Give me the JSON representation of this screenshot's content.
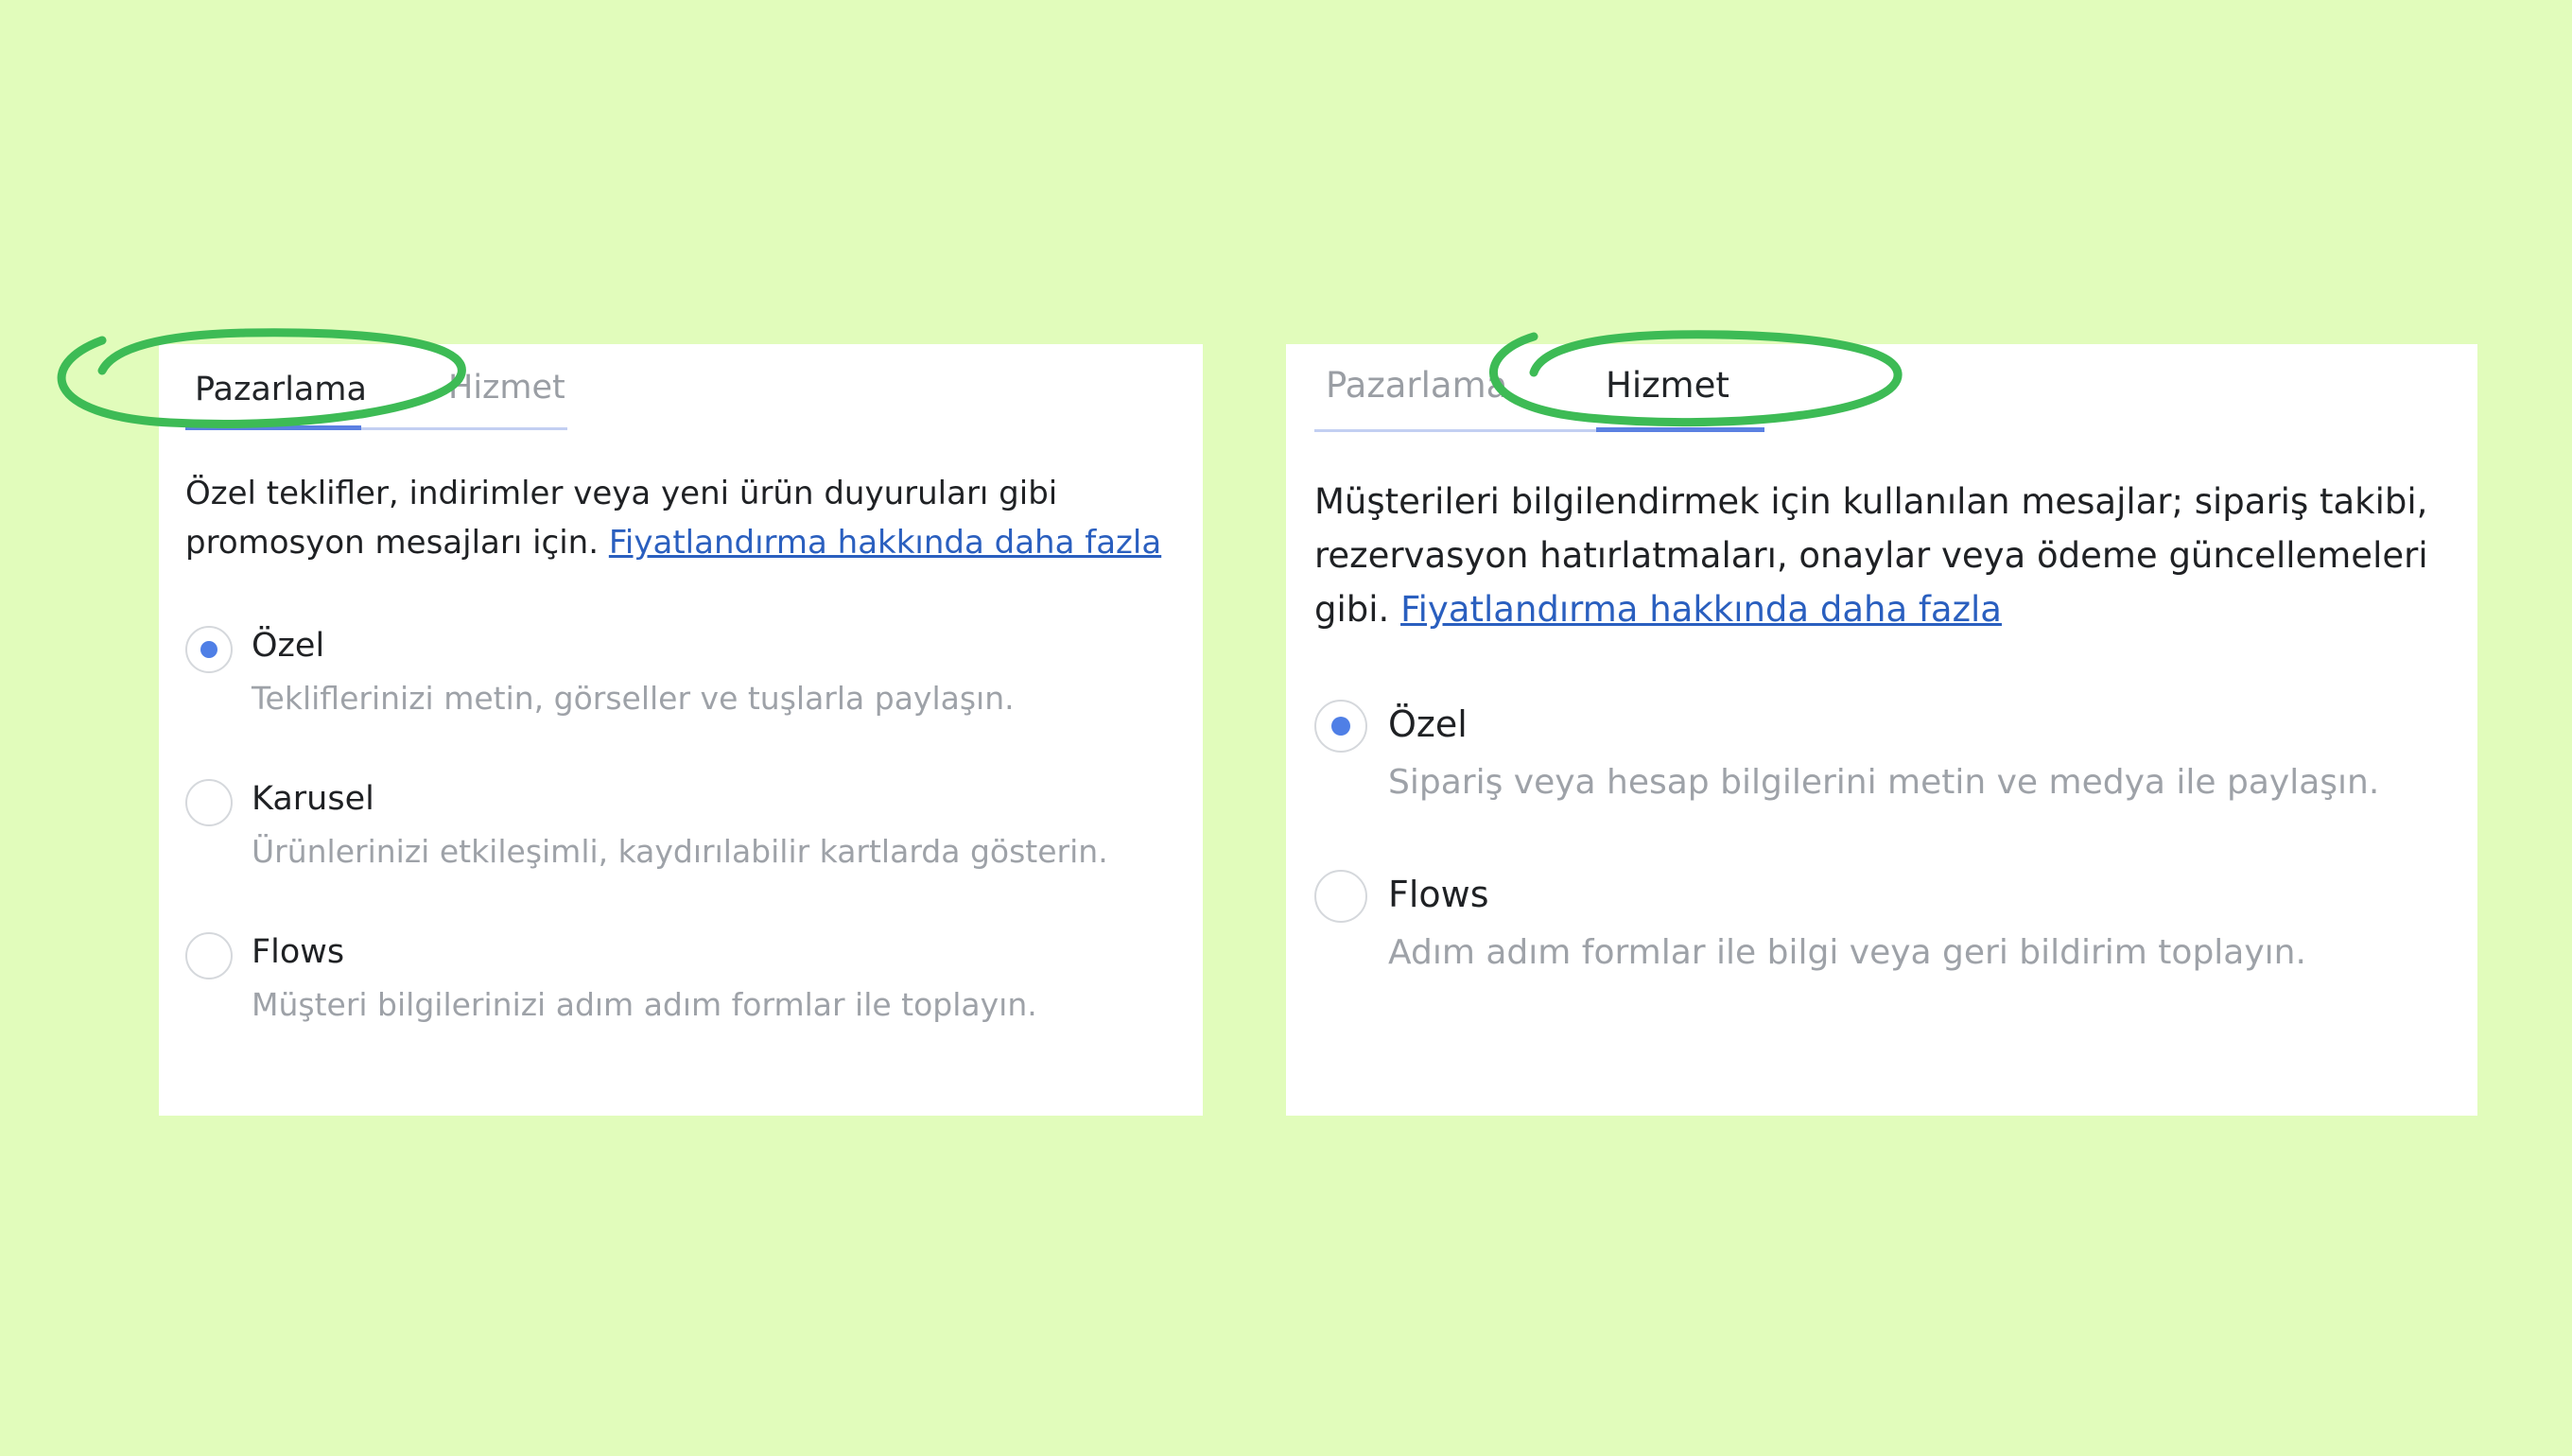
{
  "left_panel": {
    "tabs": [
      {
        "label": "Pazarlama",
        "active": true
      },
      {
        "label": "Hizmet",
        "active": false
      }
    ],
    "description": "Özel teklifler, indirimler veya yeni ürün duyuruları gibi promosyon mesajları için.",
    "link_text": "Fiyatlandırma hakkında daha fazla",
    "options": [
      {
        "title": "Özel",
        "subtitle": "Tekliflerinizi metin, görseller ve tuşlarla paylaşın.",
        "selected": true
      },
      {
        "title": "Karusel",
        "subtitle": "Ürünlerinizi etkileşimli, kaydırılabilir kartlarda gösterin.",
        "selected": false
      },
      {
        "title": "Flows",
        "subtitle": "Müşteri bilgilerinizi adım adım formlar ile toplayın.",
        "selected": false
      }
    ]
  },
  "right_panel": {
    "tabs": [
      {
        "label": "Pazarlama",
        "active": false
      },
      {
        "label": "Hizmet",
        "active": true
      }
    ],
    "description": "Müşterileri bilgilendirmek için kullanılan mesajlar; sipariş takibi, rezervasyon hatırlatmaları, onaylar veya ödeme güncellemeleri gibi.",
    "link_text": "Fiyatlandırma hakkında daha fazla",
    "options": [
      {
        "title": "Özel",
        "subtitle": "Sipariş veya hesap bilgilerini metin ve medya ile paylaşın.",
        "selected": true
      },
      {
        "title": "Flows",
        "subtitle": "Adım adım formlar ile bilgi veya geri bildirim toplayın.",
        "selected": false
      }
    ]
  },
  "colors": {
    "background": "#e1fcbb",
    "highlight_stroke": "#3dbb55",
    "accent": "#4f7fe6",
    "link": "#2a5fbf"
  },
  "icons": [
    "radio-selected-icon",
    "radio-unselected-icon"
  ]
}
